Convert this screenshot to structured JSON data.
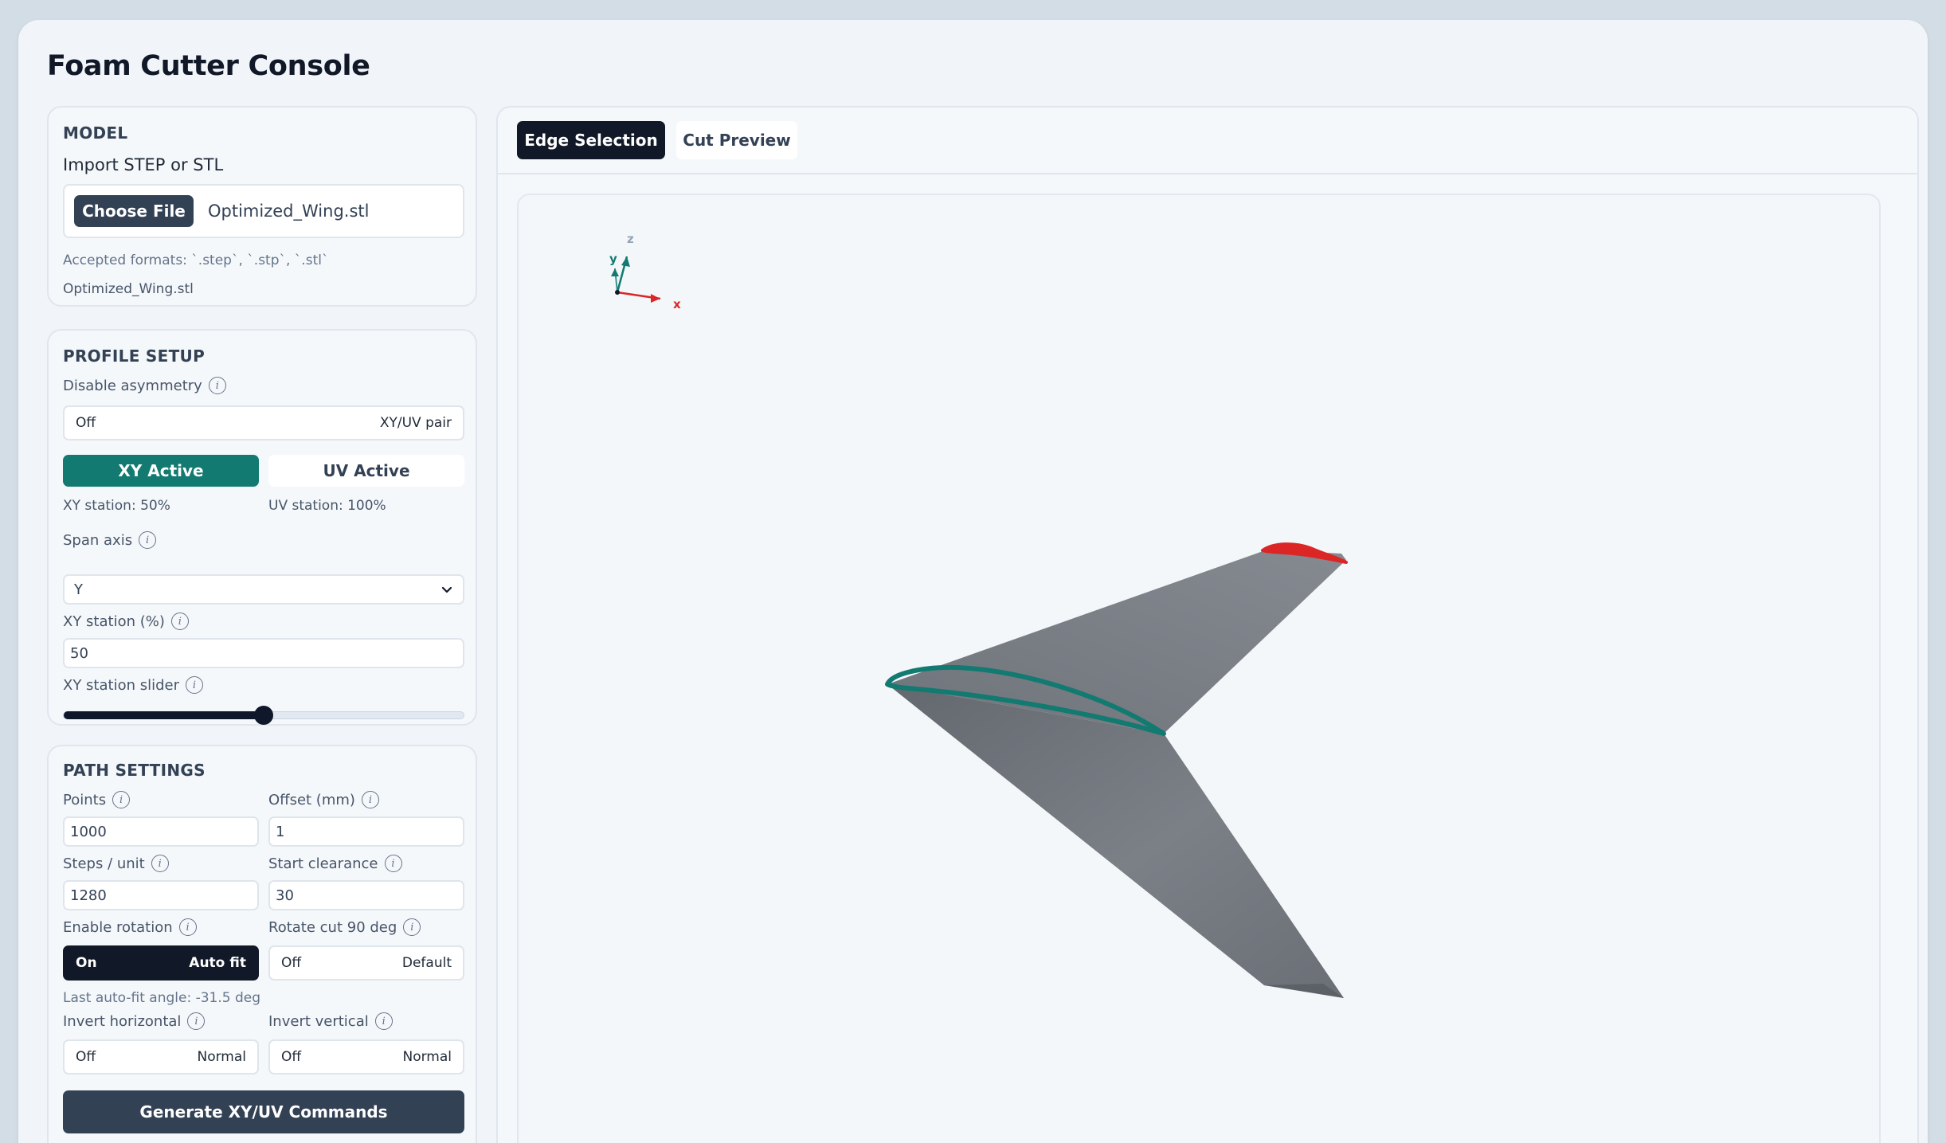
{
  "app": {
    "title": "Foam Cutter Console"
  },
  "model": {
    "section_title": "MODEL",
    "import_label": "Import STEP or STL",
    "choose_file_label": "Choose File",
    "file_name": "Optimized_Wing.stl",
    "accepted_formats": "Accepted formats: `.step`, `.stp`, `.stl`",
    "loaded_file": "Optimized_Wing.stl"
  },
  "profile": {
    "section_title": "PROFILE SETUP",
    "disable_asymmetry_label": "Disable asymmetry",
    "disable_asymmetry": {
      "state": "Off",
      "mode": "XY/UV pair"
    },
    "xy_button": "XY Active",
    "uv_button": "UV Active",
    "xy_station_text": "XY station: 50%",
    "uv_station_text": "UV station: 100%",
    "span_axis_label": "Span axis",
    "span_axis_value": "Y",
    "xy_station_pct_label": "XY station (%)",
    "xy_station_pct_value": "50",
    "xy_slider_label": "XY station slider",
    "xy_slider_value": 0.5
  },
  "path": {
    "section_title": "PATH SETTINGS",
    "points_label": "Points",
    "points_value": "1000",
    "offset_label": "Offset (mm)",
    "offset_value": "1",
    "steps_label": "Steps / unit",
    "steps_value": "1280",
    "clearance_label": "Start clearance",
    "clearance_value": "30",
    "rotation_label": "Enable rotation",
    "rotation": {
      "state": "On",
      "mode": "Auto fit"
    },
    "rotate90_label": "Rotate cut 90 deg",
    "rotate90": {
      "state": "Off",
      "mode": "Default"
    },
    "auto_fit_text": "Last auto-fit angle: -31.5 deg",
    "invert_h_label": "Invert horizontal",
    "invert_h": {
      "state": "Off",
      "mode": "Normal"
    },
    "invert_v_label": "Invert vertical",
    "invert_v": {
      "state": "Off",
      "mode": "Normal"
    },
    "generate_label": "Generate XY/UV Commands"
  },
  "viewer": {
    "tabs": [
      {
        "label": "Edge Selection"
      },
      {
        "label": "Cut Preview"
      }
    ],
    "active_tab": "Edge Selection",
    "axes": {
      "x": "x",
      "y": "y",
      "z": "z"
    }
  },
  "colors": {
    "accent": "#127a70",
    "dark": "#111827",
    "slate": "#334155",
    "wing": "#7b8087",
    "xy_edge": "#127a70",
    "uv_edge": "#dc2626",
    "axis_x": "#dc2626",
    "axis_y": "#127a70"
  }
}
